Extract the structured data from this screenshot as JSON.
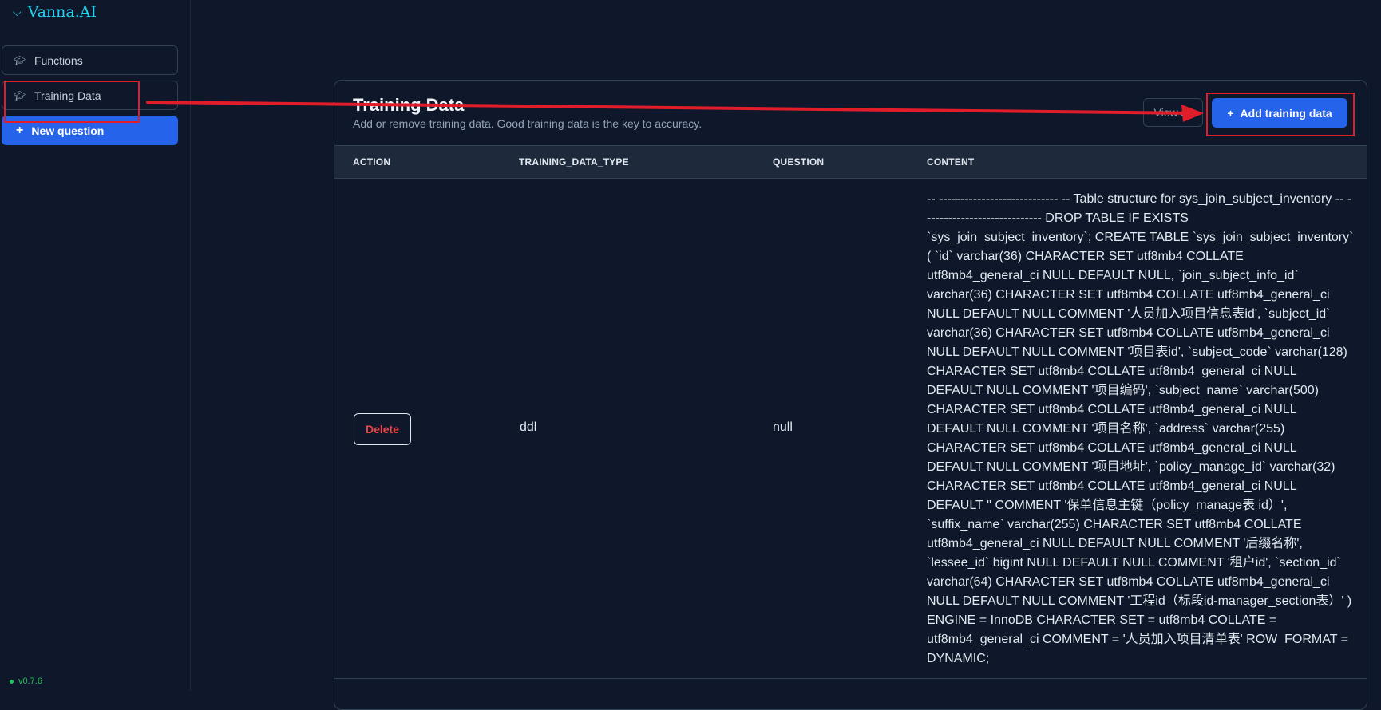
{
  "app": {
    "brand": "Vanna.AI",
    "version": "v0.7.6"
  },
  "sidebar": {
    "items": [
      {
        "label": "Functions",
        "icon": "graduation-cap-icon"
      },
      {
        "label": "Training Data",
        "icon": "graduation-cap-icon"
      }
    ],
    "new_question_label": "New question"
  },
  "main": {
    "title": "Training Data",
    "subtitle": "Add or remove training data. Good training data is the key to accuracy.",
    "view_all_label": "View all",
    "add_label": "Add training data",
    "columns": [
      "ACTION",
      "TRAINING_DATA_TYPE",
      "QUESTION",
      "CONTENT"
    ],
    "rows": [
      {
        "action_label": "Delete",
        "training_data_type": "ddl",
        "question": "null",
        "content": "-- ---------------------------- -- Table structure for sys_join_subject_inventory -- ---------------------------- DROP TABLE IF EXISTS `sys_join_subject_inventory`; CREATE TABLE `sys_join_subject_inventory` ( `id` varchar(36) CHARACTER SET utf8mb4 COLLATE utf8mb4_general_ci NULL DEFAULT NULL, `join_subject_info_id` varchar(36) CHARACTER SET utf8mb4 COLLATE utf8mb4_general_ci NULL DEFAULT NULL COMMENT '人员加入项目信息表id', `subject_id` varchar(36) CHARACTER SET utf8mb4 COLLATE utf8mb4_general_ci NULL DEFAULT NULL COMMENT '项目表id', `subject_code` varchar(128) CHARACTER SET utf8mb4 COLLATE utf8mb4_general_ci NULL DEFAULT NULL COMMENT '项目编码', `subject_name` varchar(500) CHARACTER SET utf8mb4 COLLATE utf8mb4_general_ci NULL DEFAULT NULL COMMENT '项目名称', `address` varchar(255) CHARACTER SET utf8mb4 COLLATE utf8mb4_general_ci NULL DEFAULT NULL COMMENT '项目地址', `policy_manage_id` varchar(32) CHARACTER SET utf8mb4 COLLATE utf8mb4_general_ci NULL DEFAULT '' COMMENT '保单信息主键（policy_manage表 id）', `suffix_name` varchar(255) CHARACTER SET utf8mb4 COLLATE utf8mb4_general_ci NULL DEFAULT NULL COMMENT '后缀名称', `lessee_id` bigint NULL DEFAULT NULL COMMENT '租户id', `section_id` varchar(64) CHARACTER SET utf8mb4 COLLATE utf8mb4_general_ci NULL DEFAULT NULL COMMENT '工程id（标段id-manager_section表）' ) ENGINE = InnoDB CHARACTER SET = utf8mb4 COLLATE = utf8mb4_general_ci COMMENT = '人员加入项目清单表' ROW_FORMAT = DYNAMIC;"
      }
    ]
  },
  "colors": {
    "accent": "#2563eb",
    "brand": "#22d3ee",
    "danger": "#ef4444",
    "annotation": "#e11d2a",
    "version": "#22c55e"
  }
}
